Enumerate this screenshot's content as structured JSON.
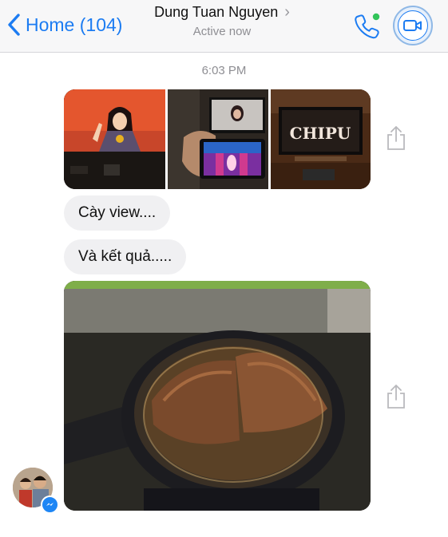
{
  "header": {
    "back_label": "Home (104)",
    "contact_name": "Dung Tuan Nguyen",
    "status": "Active now",
    "accent_color": "#1c7cf2",
    "online_color": "#32c45a"
  },
  "chat": {
    "timestamp": "6:03 PM",
    "photo_strip": {
      "photos": [
        {
          "icon": "tv-singer-photo"
        },
        {
          "icon": "phone-filming-tv-photo"
        },
        {
          "icon": "tv-chipu-photo",
          "text": "CHIPU"
        }
      ]
    },
    "messages": [
      {
        "text": "Cày view...."
      },
      {
        "text": "Và kết quả....."
      }
    ],
    "big_photo": {
      "icon": "fried-fish-in-pan-photo"
    },
    "share_icon": "share-icon"
  }
}
